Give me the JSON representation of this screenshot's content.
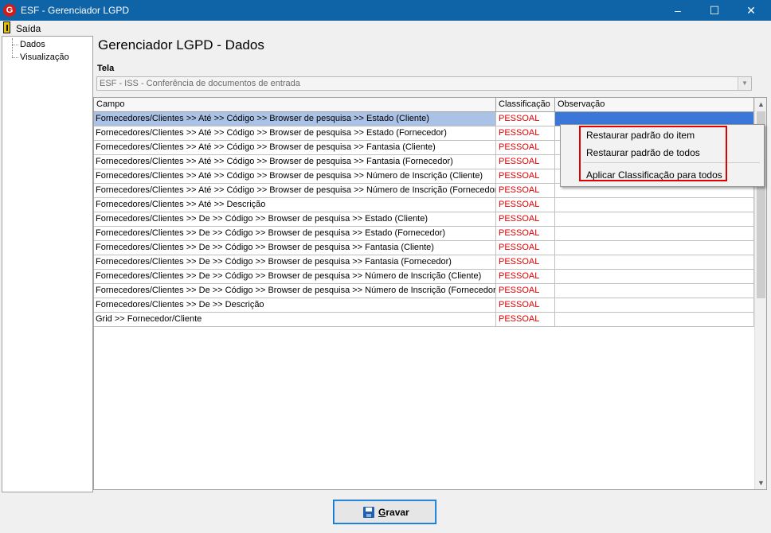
{
  "window": {
    "title": "ESF - Gerenciador LGPD",
    "logo_icon": "esf-logo-icon",
    "minimize_glyph": "–",
    "maximize_glyph": "☐",
    "close_glyph": "✕"
  },
  "menu": {
    "exit_label": "Saída",
    "exit_icon": "exit-door-icon"
  },
  "sidebar": {
    "items": [
      {
        "label": "Dados"
      },
      {
        "label": "Visualização"
      }
    ]
  },
  "page": {
    "title": "Gerenciador LGPD - Dados",
    "tela_label": "Tela"
  },
  "tela_combo": {
    "value": "ESF - ISS - Conferência de documentos de entrada"
  },
  "grid": {
    "headers": {
      "campo": "Campo",
      "classificacao": "Classificação",
      "observacao": "Observação"
    },
    "rows": [
      {
        "campo": "Fornecedores/Clientes >> Até >> Código >> Browser de pesquisa >> Estado (Cliente)",
        "classificacao": "PESSOAL",
        "observacao": ""
      },
      {
        "campo": "Fornecedores/Clientes >> Até >> Código >> Browser de pesquisa >> Estado (Fornecedor)",
        "classificacao": "PESSOAL",
        "observacao": ""
      },
      {
        "campo": "Fornecedores/Clientes >> Até >> Código >> Browser de pesquisa >> Fantasia (Cliente)",
        "classificacao": "PESSOAL",
        "observacao": ""
      },
      {
        "campo": "Fornecedores/Clientes >> Até >> Código >> Browser de pesquisa >> Fantasia (Fornecedor)",
        "classificacao": "PESSOAL",
        "observacao": ""
      },
      {
        "campo": "Fornecedores/Clientes >> Até >> Código >> Browser de pesquisa >> Número de Inscrição (Cliente)",
        "classificacao": "PESSOAL",
        "observacao": ""
      },
      {
        "campo": "Fornecedores/Clientes >> Até >> Código >> Browser de pesquisa >> Número de Inscrição (Fornecedor)",
        "classificacao": "PESSOAL",
        "observacao": ""
      },
      {
        "campo": "Fornecedores/Clientes >> Até >> Descrição",
        "classificacao": "PESSOAL",
        "observacao": ""
      },
      {
        "campo": "Fornecedores/Clientes >> De >> Código >> Browser de pesquisa >> Estado (Cliente)",
        "classificacao": "PESSOAL",
        "observacao": ""
      },
      {
        "campo": "Fornecedores/Clientes >> De >> Código >> Browser de pesquisa >> Estado (Fornecedor)",
        "classificacao": "PESSOAL",
        "observacao": ""
      },
      {
        "campo": "Fornecedores/Clientes >> De >> Código >> Browser de pesquisa >> Fantasia (Cliente)",
        "classificacao": "PESSOAL",
        "observacao": ""
      },
      {
        "campo": "Fornecedores/Clientes >> De >> Código >> Browser de pesquisa >> Fantasia (Fornecedor)",
        "classificacao": "PESSOAL",
        "observacao": ""
      },
      {
        "campo": "Fornecedores/Clientes >> De >> Código >> Browser de pesquisa >> Número de Inscrição (Cliente)",
        "classificacao": "PESSOAL",
        "observacao": ""
      },
      {
        "campo": "Fornecedores/Clientes >> De >> Código >> Browser de pesquisa >> Número de Inscrição (Fornecedor)",
        "classificacao": "PESSOAL",
        "observacao": ""
      },
      {
        "campo": "Fornecedores/Clientes >> De >> Descrição",
        "classificacao": "PESSOAL",
        "observacao": ""
      },
      {
        "campo": "Grid >> Fornecedor/Cliente",
        "classificacao": "PESSOAL",
        "observacao": ""
      }
    ],
    "selected_row": 0
  },
  "context_menu": {
    "items": [
      {
        "label": "Restaurar padrão do item"
      },
      {
        "label": "Restaurar padrão de todos"
      },
      {
        "label": "Aplicar Classificação para todos"
      }
    ]
  },
  "footer": {
    "save_label": "Gravar",
    "save_icon": "floppy-disk-icon"
  },
  "colors": {
    "titlebar": "#0f64a8",
    "classification_text": "#e00000",
    "selected_row": "#abc2e7",
    "selected_cell": "#3a77d8",
    "highlight_box": "#e00000"
  }
}
